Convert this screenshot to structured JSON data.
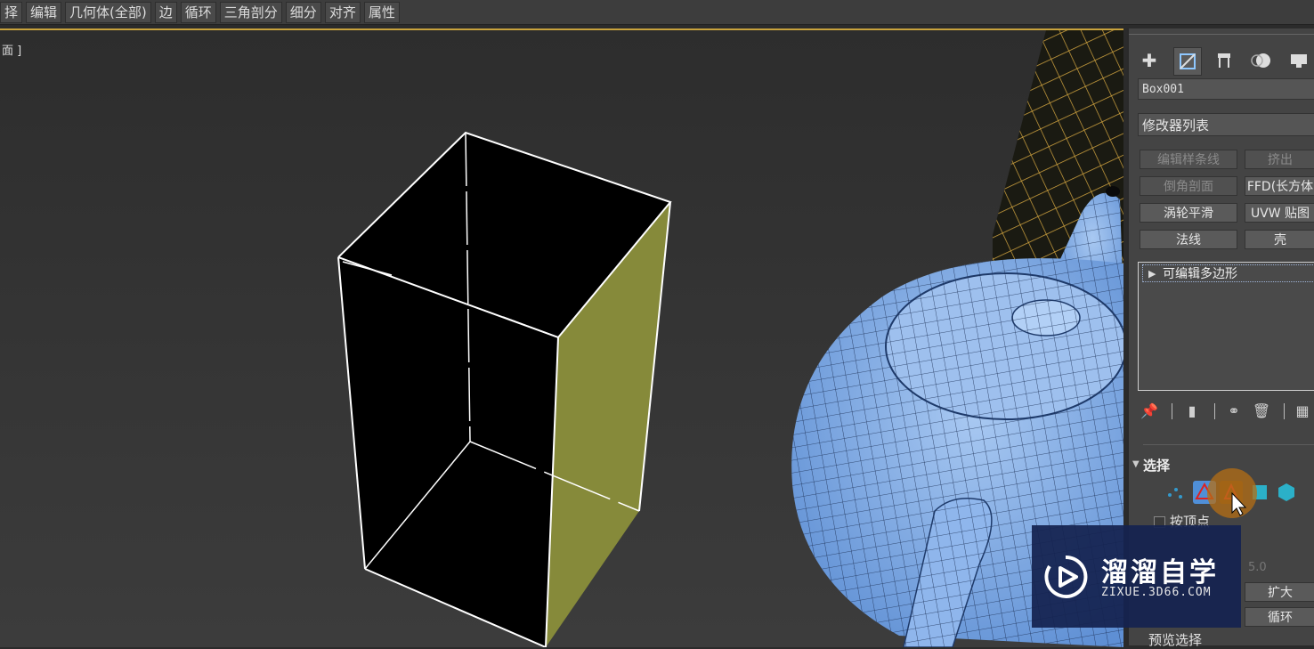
{
  "menubar": {
    "items": [
      "择",
      "编辑",
      "几何体(全部)",
      "边",
      "循环",
      "三角剖分",
      "细分",
      "对齐",
      "属性"
    ]
  },
  "viewport": {
    "label": "面 ]",
    "frame_color": "#c8a23c",
    "face_color": "#868a3a",
    "mesh_color": "#7aa7e6"
  },
  "command_panel": {
    "tabs": [
      "create-icon",
      "modify-icon",
      "hierarchy-icon",
      "motion-icon",
      "display-icon"
    ],
    "object_name": "Box001",
    "modifier_list": "修改器列表",
    "modifier_buttons": [
      {
        "label": "编辑样条线",
        "enabled": false
      },
      {
        "label": "挤出",
        "enabled": false
      },
      {
        "label": "倒角剖面",
        "enabled": false
      },
      {
        "label": "FFD(长方体",
        "enabled": true
      },
      {
        "label": "涡轮平滑",
        "enabled": true
      },
      {
        "label": "UVW 贴图",
        "enabled": true
      },
      {
        "label": "法线",
        "enabled": true
      },
      {
        "label": "壳",
        "enabled": true
      }
    ],
    "stack": {
      "item": "可编辑多边形"
    },
    "stack_tools": [
      "pin-icon",
      "show-end-result-icon",
      "make-unique-icon",
      "remove-modifier-icon",
      "configure-icon"
    ],
    "selection_rollout": {
      "title": "选择",
      "subobject_icons": [
        "vertex-icon",
        "edge-icon",
        "border-icon",
        "polygon-icon",
        "element-icon"
      ],
      "by_vertex_label": "按顶点",
      "threshold_value": "5.0",
      "grow_button": "扩大",
      "loop_button": "循环",
      "preview_label": "预览选择"
    }
  },
  "watermark": {
    "brand": "溜溜自学",
    "url": "ZIXUE.3D66.COM"
  }
}
